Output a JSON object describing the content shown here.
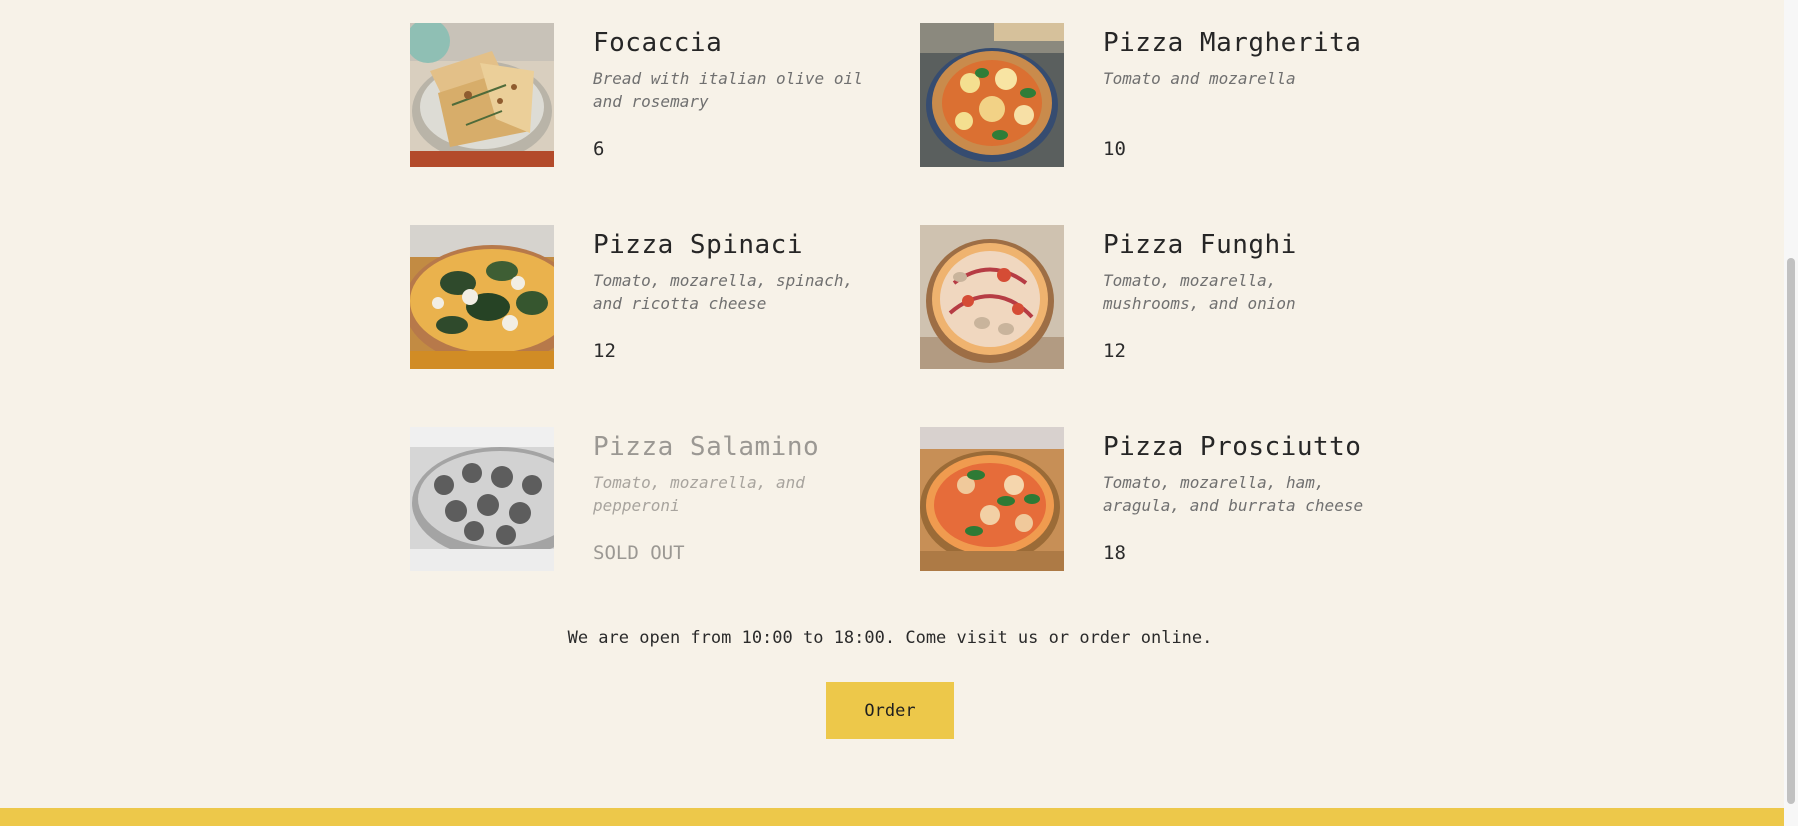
{
  "menu": {
    "items": [
      {
        "name": "Focaccia",
        "ingredients": "Bread with italian olive oil and rosemary",
        "price": "6",
        "sold_out": false,
        "photo": "focaccia"
      },
      {
        "name": "Pizza Margherita",
        "ingredients": "Tomato and mozarella",
        "price": "10",
        "sold_out": false,
        "photo": "margherita"
      },
      {
        "name": "Pizza Spinaci",
        "ingredients": "Tomato, mozarella, spinach, and ricotta cheese",
        "price": "12",
        "sold_out": false,
        "photo": "spinaci"
      },
      {
        "name": "Pizza Funghi",
        "ingredients": "Tomato, mozarella, mushrooms, and onion",
        "price": "12",
        "sold_out": false,
        "photo": "funghi"
      },
      {
        "name": "Pizza Salamino",
        "ingredients": "Tomato, mozarella, and pepperoni",
        "price": "SOLD OUT",
        "sold_out": true,
        "photo": "salamino"
      },
      {
        "name": "Pizza Prosciutto",
        "ingredients": "Tomato, mozarella, ham, aragula, and burrata cheese",
        "price": "18",
        "sold_out": false,
        "photo": "prosciutto"
      }
    ]
  },
  "footer_info": {
    "open_text": "We are open from 10:00 to 18:00. Come visit us or order online.",
    "order_label": "Order"
  },
  "colors": {
    "background": "#f7f2e8",
    "accent": "#edc84a",
    "text": "#2b2b2b",
    "muted": "#707070",
    "sold_out": "#9b9893"
  }
}
